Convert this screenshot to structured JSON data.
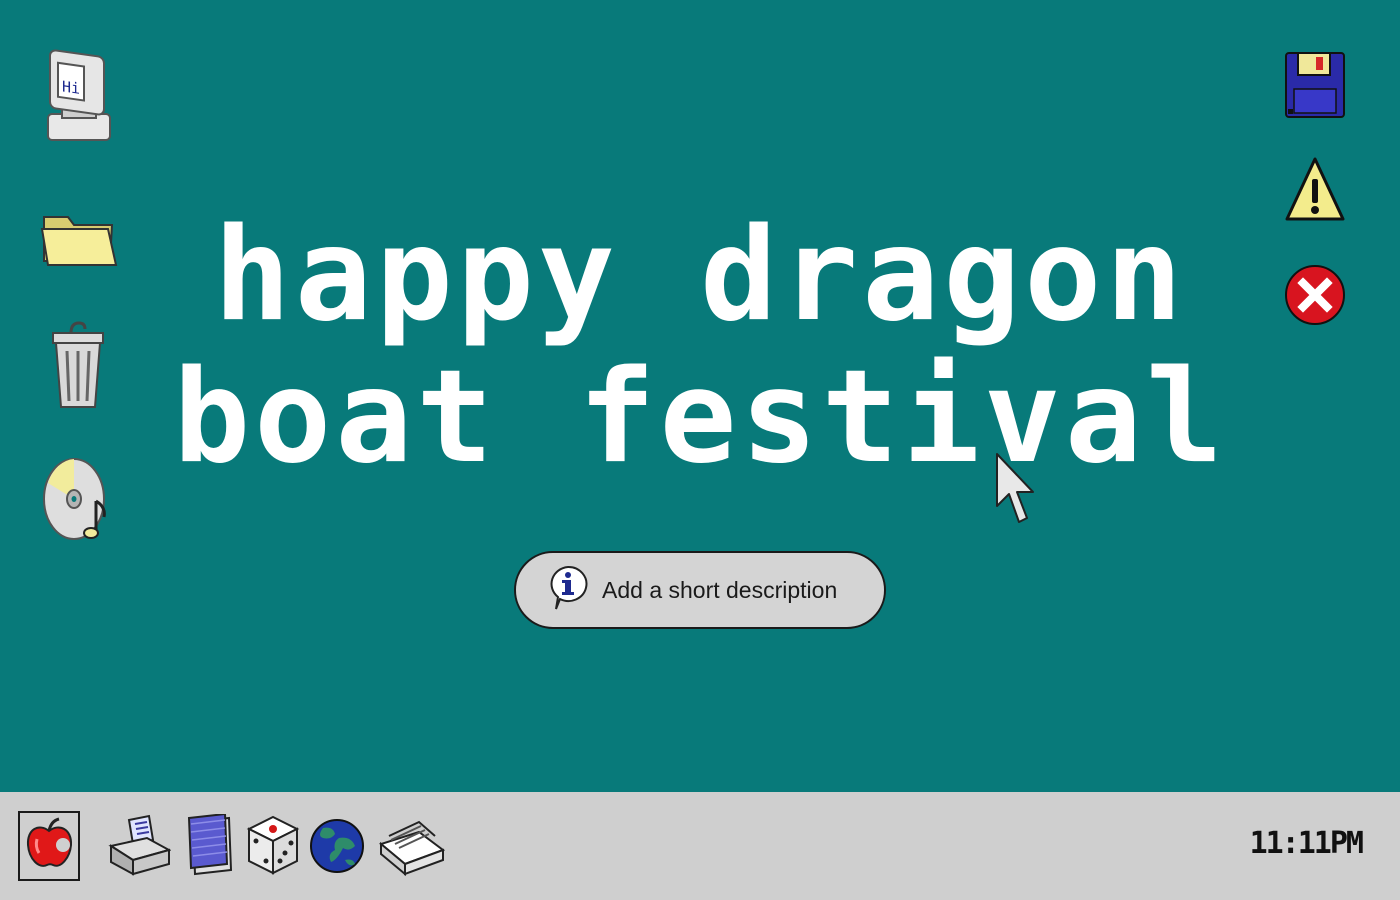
{
  "desktop": {
    "left_icons": [
      {
        "name": "computer-icon"
      },
      {
        "name": "folder-icon"
      },
      {
        "name": "trash-icon"
      },
      {
        "name": "cd-music-icon"
      }
    ],
    "right_icons": [
      {
        "name": "floppy-disk-icon"
      },
      {
        "name": "warning-icon"
      },
      {
        "name": "error-icon"
      }
    ],
    "computer_screen_text": "Hi",
    "headline": {
      "line1": "happy dragon",
      "line2": "boat festival"
    },
    "description_button": {
      "label": "Add a short description",
      "icon": "info-bubble-icon"
    }
  },
  "taskbar": {
    "start_icon": "apple-icon",
    "apps": [
      {
        "name": "printer-icon"
      },
      {
        "name": "notepad-icon"
      },
      {
        "name": "dice-icon"
      },
      {
        "name": "globe-icon"
      },
      {
        "name": "scanner-icon"
      }
    ],
    "clock": "11:11PM"
  },
  "colors": {
    "desktop_bg": "#087a7a",
    "taskbar_bg": "#cfcfcf",
    "headline": "#ffffff"
  }
}
